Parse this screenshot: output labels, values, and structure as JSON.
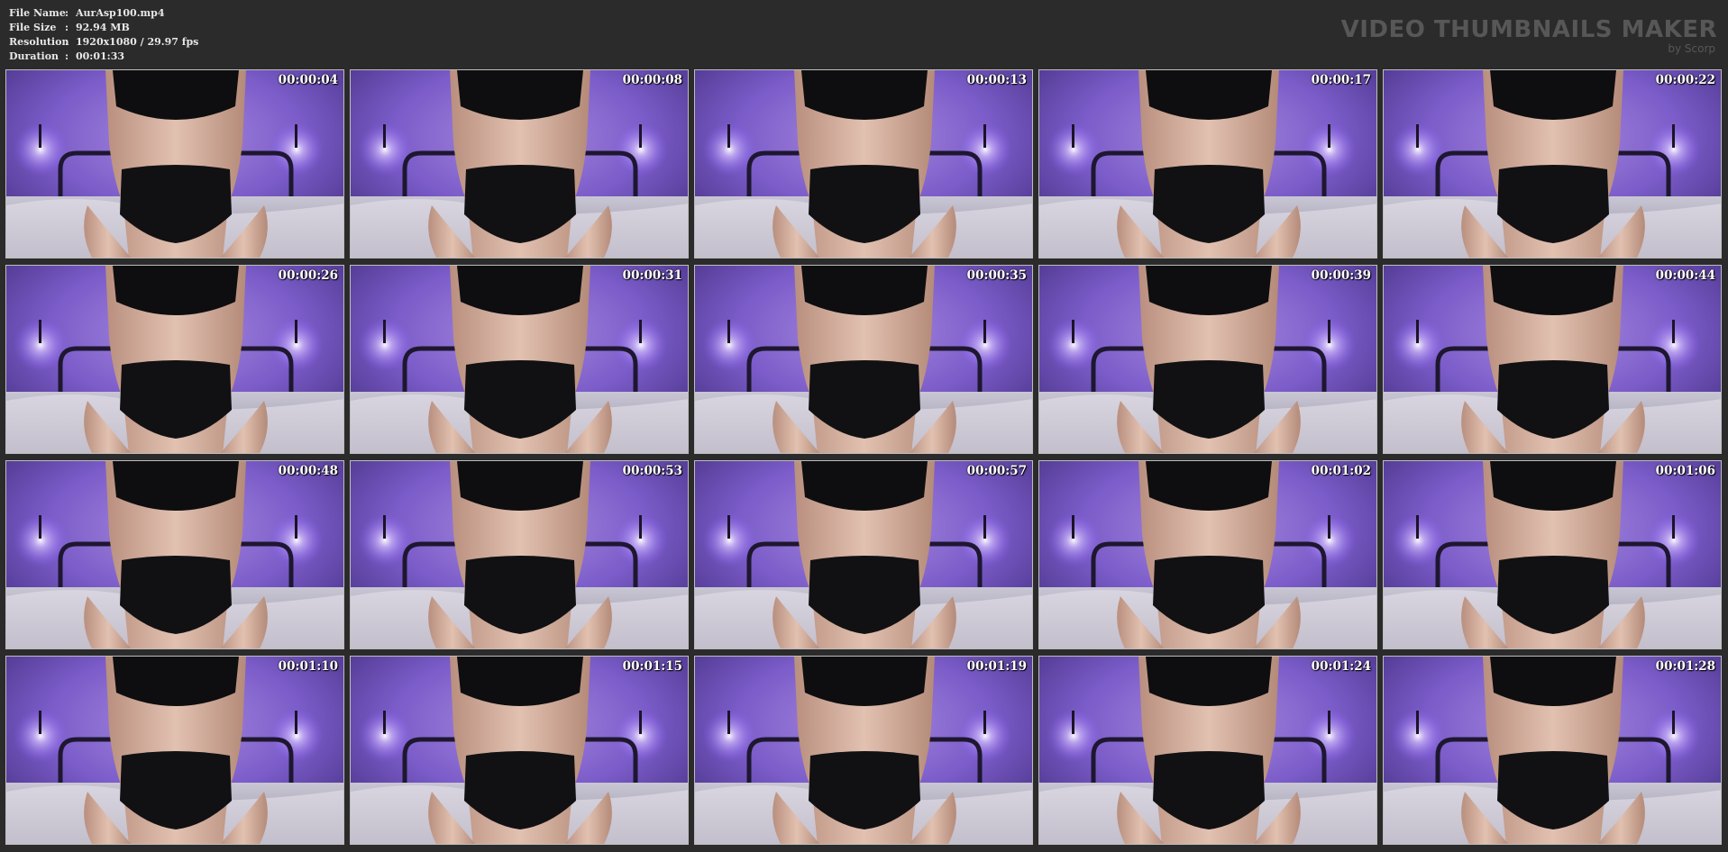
{
  "info": [
    {
      "label": "File Name",
      "sep": ":",
      "value": "AurAsp100.mp4"
    },
    {
      "label": "File Size",
      "sep": ":",
      "value": "92.94 MB"
    },
    {
      "label": "Resolution",
      "sep": ":",
      "value": "1920x1080 / 29.97 fps"
    },
    {
      "label": "Duration",
      "sep": ":",
      "value": "00:01:33"
    }
  ],
  "brand": {
    "title": "VIDEO THUMBNAILS MAKER",
    "subtitle": "by Scorp"
  },
  "colors": {
    "background": "#2b2b2b",
    "brand": "#575757",
    "thumb_border": "#bdbdbd"
  },
  "thumbnails": [
    {
      "time": "00:00:04"
    },
    {
      "time": "00:00:08"
    },
    {
      "time": "00:00:13"
    },
    {
      "time": "00:00:17"
    },
    {
      "time": "00:00:22"
    },
    {
      "time": "00:00:26"
    },
    {
      "time": "00:00:31"
    },
    {
      "time": "00:00:35"
    },
    {
      "time": "00:00:39"
    },
    {
      "time": "00:00:44"
    },
    {
      "time": "00:00:48"
    },
    {
      "time": "00:00:53"
    },
    {
      "time": "00:00:57"
    },
    {
      "time": "00:01:02"
    },
    {
      "time": "00:01:06"
    },
    {
      "time": "00:01:10"
    },
    {
      "time": "00:01:15"
    },
    {
      "time": "00:01:19"
    },
    {
      "time": "00:01:24"
    },
    {
      "time": "00:01:28"
    }
  ]
}
